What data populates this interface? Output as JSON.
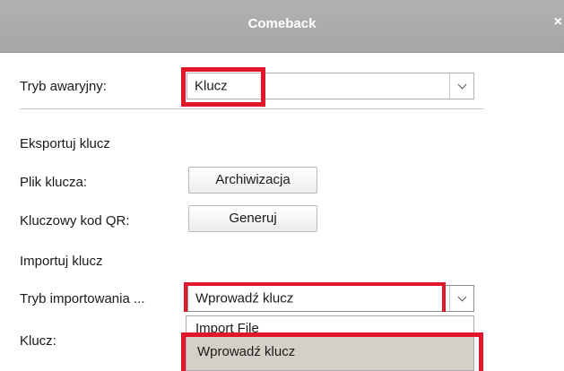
{
  "window": {
    "title": "Comeback",
    "close_symbol": "×"
  },
  "emergency_mode": {
    "label": "Tryb awaryjny:",
    "selected": "Klucz"
  },
  "export_section": {
    "heading": "Eksportuj klucz",
    "key_file_label": "Plik klucza:",
    "backup_button": "Archiwizacja",
    "qr_label": "Kluczowy kod QR:",
    "generate_button": "Generuj"
  },
  "import_section": {
    "heading": "Importuj klucz",
    "mode_label": "Tryb importowania ...",
    "mode_selected": "Wprowadź klucz",
    "key_label": "Klucz:",
    "options": [
      "Import File",
      "Wprowadź klucz"
    ]
  },
  "colors": {
    "highlight": "#e0162b",
    "selected_option_bg": "#d4d0c8",
    "titlebar": "#aaaaaa"
  }
}
